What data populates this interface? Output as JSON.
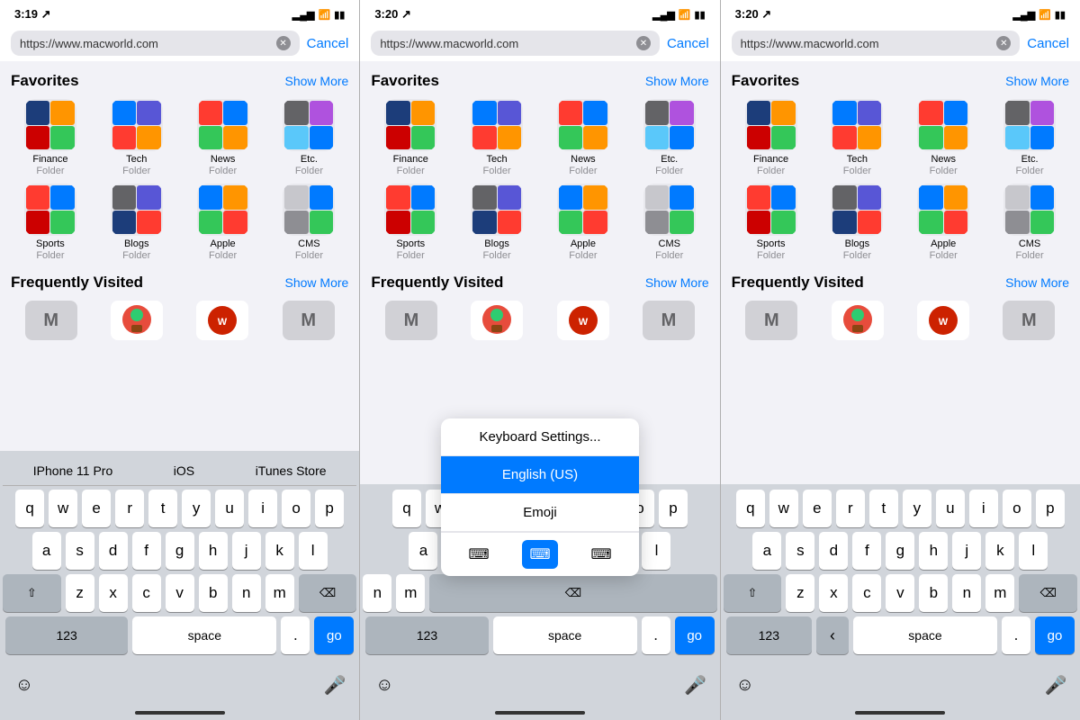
{
  "phones": [
    {
      "id": "phone1",
      "statusBar": {
        "time": "3:19",
        "locationIcon": true,
        "signal": "▂▄▆",
        "wifi": "wifi",
        "battery": "battery"
      },
      "urlBar": {
        "url": "https://www.macworld.com",
        "cancelLabel": "Cancel"
      },
      "favorites": {
        "title": "Favorites",
        "showMore": "Show More",
        "folders": [
          {
            "name": "Finance",
            "type": "Folder"
          },
          {
            "name": "Tech",
            "type": "Folder"
          },
          {
            "name": "News",
            "type": "Folder"
          },
          {
            "name": "Etc.",
            "type": "Folder"
          },
          {
            "name": "Sports",
            "type": "Folder"
          },
          {
            "name": "Blogs",
            "type": "Folder"
          },
          {
            "name": "Apple",
            "type": "Folder"
          },
          {
            "name": "CMS",
            "type": "Folder"
          }
        ]
      },
      "frequentlyVisited": {
        "title": "Frequently Visited",
        "showMore": "Show More"
      },
      "keyboard": {
        "suggestions": [
          "IPhone 11 Pro",
          "iOS",
          "iTunes Store"
        ],
        "showSuggestions": true,
        "showPopup": false
      }
    },
    {
      "id": "phone2",
      "statusBar": {
        "time": "3:20"
      },
      "urlBar": {
        "url": "https://www.macworld.com",
        "cancelLabel": "Cancel"
      },
      "favorites": {
        "title": "Favorites",
        "showMore": "Show More",
        "folders": [
          {
            "name": "Finance",
            "type": "Folder"
          },
          {
            "name": "Tech",
            "type": "Folder"
          },
          {
            "name": "News",
            "type": "Folder"
          },
          {
            "name": "Etc.",
            "type": "Folder"
          },
          {
            "name": "Sports",
            "type": "Folder"
          },
          {
            "name": "Blogs",
            "type": "Folder"
          },
          {
            "name": "Apple",
            "type": "Folder"
          },
          {
            "name": "CMS",
            "type": "Folder"
          }
        ]
      },
      "frequentlyVisited": {
        "title": "Frequently Visited",
        "showMore": "Show More"
      },
      "keyboard": {
        "showPopup": true,
        "popupItems": [
          {
            "label": "Keyboard Settings...",
            "active": false
          },
          {
            "label": "English (US)",
            "active": true
          },
          {
            "label": "Emoji",
            "active": false
          }
        ]
      }
    },
    {
      "id": "phone3",
      "statusBar": {
        "time": "3:20"
      },
      "urlBar": {
        "url": "https://www.macworld.com",
        "cancelLabel": "Cancel"
      },
      "favorites": {
        "title": "Favorites",
        "showMore": "Show More",
        "folders": [
          {
            "name": "Finance",
            "type": "Folder"
          },
          {
            "name": "Tech",
            "type": "Folder"
          },
          {
            "name": "News",
            "type": "Folder"
          },
          {
            "name": "Etc.",
            "type": "Folder"
          },
          {
            "name": "Sports",
            "type": "Folder"
          },
          {
            "name": "Blogs",
            "type": "Folder"
          },
          {
            "name": "Apple",
            "type": "Folder"
          },
          {
            "name": "CMS",
            "type": "Folder"
          }
        ]
      },
      "frequentlyVisited": {
        "title": "Frequently Visited",
        "showMore": "Show More"
      },
      "keyboard": {
        "showPopup": false,
        "showChevron": true
      }
    }
  ],
  "folderColors": {
    "Finance": [
      [
        "#1c3d7a",
        "#cc0000",
        "#ff9500",
        "#34c759"
      ],
      [
        "#ff3b30",
        "#5856d6",
        "#007aff",
        "#ff2d55"
      ],
      [
        "#636366",
        "#ff9500",
        "#5ac8fa",
        "#af52de"
      ],
      [
        "#c7c7cc",
        "#8e8e93",
        "#ffcc00",
        "#34c759"
      ]
    ],
    "Tech": [
      [
        "#007aff",
        "#ff9500",
        "#34c759",
        "#5856d6"
      ],
      [
        "#1c3d7a",
        "#cc0000",
        "#af52de",
        "#ff3b30"
      ],
      [
        "#ffcc00",
        "#5ac8fa",
        "#8e8e93",
        "#636366"
      ],
      [
        "#ff2d55",
        "#007aff",
        "#ff9500",
        "#34c759"
      ]
    ],
    "News": [
      [
        "#ff3b30",
        "#34c759",
        "#007aff",
        "#ff9500"
      ],
      [
        "#5856d6",
        "#1c3d7a",
        "#cc0000",
        "#af52de"
      ],
      [
        "#8e8e93",
        "#ffcc00",
        "#636366",
        "#5ac8fa"
      ],
      [
        "#c7c7cc",
        "#ff2d55",
        "#007aff",
        "#ff9500"
      ]
    ],
    "Etc.": [
      [
        "#636366",
        "#5ac8fa",
        "#af52de",
        "#007aff"
      ],
      [
        "#cc0000",
        "#ff9500",
        "#1c3d7a",
        "#34c759"
      ],
      [
        "#ff3b30",
        "#5856d6",
        "#ffcc00",
        "#ff2d55"
      ],
      [
        "#8e8e93",
        "#c7c7cc",
        "#636366",
        "#007aff"
      ]
    ],
    "Sports": [
      [
        "#ff3b30",
        "#34c759",
        "#007aff",
        "#ff9500"
      ],
      [
        "#cc0000",
        "#5856d6",
        "#ff2d55",
        "#af52de"
      ],
      [
        "#636366",
        "#8e8e93",
        "#ffcc00",
        "#5ac8fa"
      ],
      [
        "#1c3d7a",
        "#c7c7cc",
        "#ff3b30",
        "#34c759"
      ]
    ],
    "Blogs": [
      [
        "#8e8e93",
        "#636366",
        "#ff3b30",
        "#5856d6"
      ],
      [
        "#1c3d7a",
        "#007aff",
        "#cc0000",
        "#ff9500"
      ],
      [
        "#af52de",
        "#34c759",
        "#ffcc00",
        "#ff2d55"
      ],
      [
        "#5ac8fa",
        "#c7c7cc",
        "#636366",
        "#8e8e93"
      ]
    ],
    "Apple": [
      [
        "#007aff",
        "#34c759",
        "#ff9500",
        "#ff3b30"
      ],
      [
        "#5856d6",
        "#af52de",
        "#1c3d7a",
        "#cc0000"
      ],
      [
        "#ffcc00",
        "#5ac8fa",
        "#636366",
        "#8e8e93"
      ],
      [
        "#ff2d55",
        "#c7c7cc",
        "#007aff",
        "#34c759"
      ]
    ],
    "CMS": [
      [
        "#c7c7cc",
        "#8e8e93",
        "#636366",
        "#007aff"
      ],
      [
        "#34c759",
        "#ff9500",
        "#ff3b30",
        "#5856d6"
      ],
      [
        "#1c3d7a",
        "#af52de",
        "#cc0000",
        "#ff2d55"
      ],
      [
        "#5ac8fa",
        "#ffcc00",
        "#636366",
        "#c7c7cc"
      ]
    ]
  }
}
